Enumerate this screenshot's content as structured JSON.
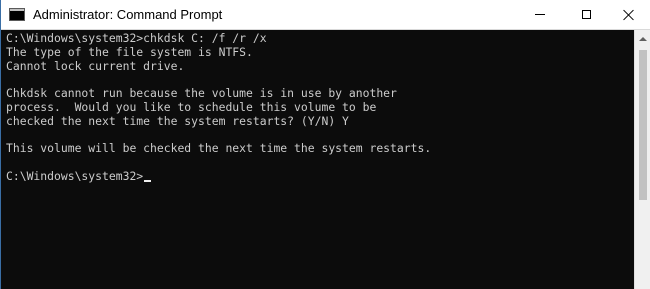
{
  "window": {
    "title": "Administrator: Command Prompt",
    "app_icon_text": "C:\\",
    "controls": {
      "minimize": "minimize-icon",
      "maximize": "maximize-icon",
      "close": "close-icon"
    }
  },
  "console": {
    "background": "#0c0c0c",
    "foreground": "#cccccc",
    "lines": [
      "C:\\Windows\\system32>chkdsk C: /f /r /x",
      "The type of the file system is NTFS.",
      "Cannot lock current drive.",
      "",
      "Chkdsk cannot run because the volume is in use by another",
      "process.  Would you like to schedule this volume to be",
      "checked the next time the system restarts? (Y/N) Y",
      "",
      "This volume will be checked the next time the system restarts.",
      "",
      "C:\\Windows\\system32>"
    ]
  }
}
